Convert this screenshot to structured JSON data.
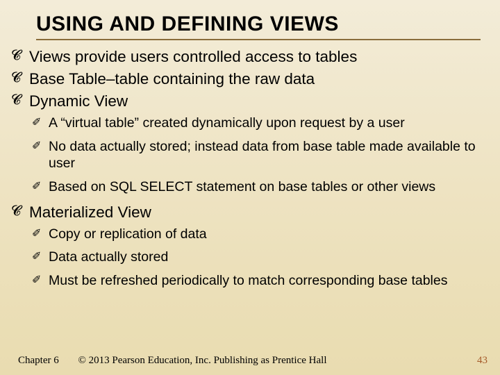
{
  "title": "USING AND DEFINING VIEWS",
  "bullets": {
    "b0": "Views provide users controlled access to tables",
    "b1": "Base Table–table containing the raw data",
    "b2": "Dynamic View",
    "b2_sub": {
      "s0": "A “virtual table” created dynamically upon request by a user",
      "s1": "No data actually stored; instead data from base table made available to user",
      "s2": "Based on SQL SELECT statement on base tables or other views"
    },
    "b3": "Materialized View",
    "b3_sub": {
      "s0": "Copy or replication of data",
      "s1": "Data actually stored",
      "s2": "Must be refreshed periodically to match corresponding base tables"
    }
  },
  "footer": {
    "chapter": "Chapter 6",
    "copyright": "© 2013 Pearson Education, Inc.  Publishing as Prentice Hall"
  },
  "page_number": "43"
}
